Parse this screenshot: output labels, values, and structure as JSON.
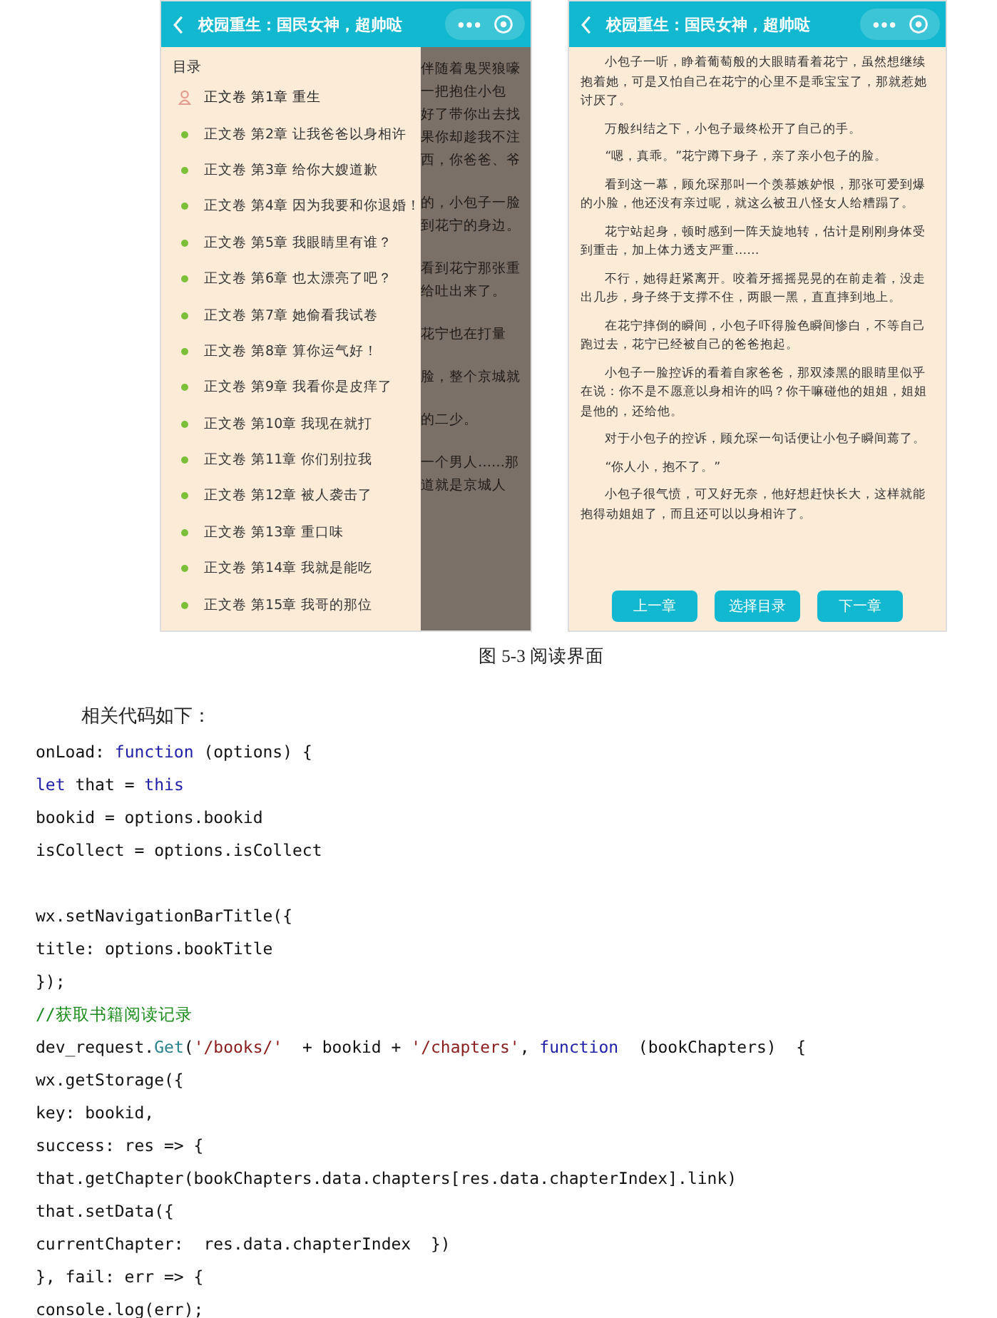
{
  "screens": [
    {
      "kind": "menu",
      "title": "校园重生：国民女神，超帅哒",
      "background_text": [
        [
          "伴随着鬼哭狼嚎",
          "一把抱住小包",
          "好了带你出去找",
          "果你却趁我不注",
          "西，你爸爸、爷"
        ],
        [
          "的，小包子一脸",
          "到花宁的身边。"
        ],
        [
          "看到花宁那张重",
          "给吐出来了。"
        ],
        [
          "花宁也在打量"
        ],
        [
          "脸，整个京城就"
        ],
        [
          "的二少。"
        ],
        [
          "一个男人……那",
          "道就是京城人"
        ]
      ],
      "toc_heading": "目录",
      "chapters": [
        {
          "label": "正文卷 第1章 重生",
          "selected": true
        },
        {
          "label": "正文卷 第2章 让我爸爸以身相许",
          "selected": false
        },
        {
          "label": "正文卷 第3章 给你大嫂道歉",
          "selected": false
        },
        {
          "label": "正文卷 第4章 因为我要和你退婚！",
          "selected": false
        },
        {
          "label": "正文卷 第5章 我眼睛里有谁？",
          "selected": false
        },
        {
          "label": "正文卷 第6章 也太漂亮了吧？",
          "selected": false
        },
        {
          "label": "正文卷 第7章 她偷看我试卷",
          "selected": false
        },
        {
          "label": "正文卷 第8章 算你运气好！",
          "selected": false
        },
        {
          "label": "正文卷 第9章 我看你是皮痒了",
          "selected": false
        },
        {
          "label": "正文卷 第10章 我现在就打",
          "selected": false
        },
        {
          "label": "正文卷 第11章 你们别拉我",
          "selected": false
        },
        {
          "label": "正文卷 第12章 被人袭击了",
          "selected": false
        },
        {
          "label": "正文卷 第13章 重口味",
          "selected": false
        },
        {
          "label": "正文卷 第14章 我就是能吃",
          "selected": false
        },
        {
          "label": "正文卷 第15章 我哥的那位",
          "selected": false
        }
      ]
    },
    {
      "kind": "reader",
      "title": "校园重生：国民女神，超帅哒",
      "paragraphs": [
        "小包子一听，睁着葡萄般的大眼睛看着花宁，虽然想继续抱着她，可是又怕自己在花宁的心里不是乖宝宝了，那就惹她讨厌了。",
        "万般纠结之下，小包子最终松开了自己的手。",
        "“嗯，真乖。”花宁蹲下身子，亲了亲小包子的脸。",
        "看到这一幕，顾允琛那叫一个羡慕嫉妒恨，那张可爱到爆的小脸，他还没有亲过呢，就这么被丑八怪女人给糟蹋了。",
        "花宁站起身，顿时感到一阵天旋地转，估计是刚刚身体受到重击，加上体力透支严重……",
        "不行，她得赶紧离开。咬着牙摇摇晃晃的在前走着，没走出几步，身子终于支撑不住，两眼一黑，直直摔到地上。",
        "在花宁摔倒的瞬间，小包子吓得脸色瞬间惨白，不等自己跑过去，花宁已经被自己的爸爸抱起。",
        "小包子一脸控诉的看着自家爸爸，那双漆黑的眼睛里似乎在说：你不是不愿意以身相许的吗？你干嘛碰他的姐姐，姐姐是他的，还给他。",
        "对于小包子的控诉，顾允琛一句话便让小包子瞬间蔫了。",
        "“你人小，抱不了。”",
        "小包子很气愤，可又好无奈，他好想赶快长大，这样就能抱得动姐姐了，而且还可以以身相许了。"
      ],
      "buttons": [
        "上一章",
        "选择目录",
        "下一章"
      ]
    }
  ],
  "caption": "图 5-3  阅读界面",
  "intro": "相关代码如下：",
  "code_lines": [
    [
      {
        "kind": "plain",
        "text": "onLoad: "
      },
      {
        "kind": "keyword",
        "text": "function"
      },
      {
        "kind": "plain",
        "text": " (options) {"
      }
    ],
    [
      {
        "kind": "keyword",
        "text": "let"
      },
      {
        "kind": "plain",
        "text": " that = "
      },
      {
        "kind": "keyword",
        "text": "this"
      }
    ],
    [
      {
        "kind": "plain",
        "text": "bookid = options.bookid"
      }
    ],
    [
      {
        "kind": "plain",
        "text": "isCollect = options.isCollect"
      }
    ],
    [
      {
        "kind": "blank"
      },
      {
        "kind": "plain",
        "text": "wx.setNavigationBarTitle({"
      }
    ],
    [
      {
        "kind": "plain",
        "text": "title: options.bookTitle"
      }
    ],
    [
      {
        "kind": "plain",
        "text": "});"
      }
    ],
    [
      {
        "kind": "comment",
        "text": "//获取书籍阅读记录"
      }
    ],
    [
      {
        "kind": "plain",
        "text": "dev_request."
      },
      {
        "kind": "method",
        "text": "Get"
      },
      {
        "kind": "plain",
        "text": "("
      },
      {
        "kind": "string",
        "text": "'/books/'"
      },
      {
        "kind": "plain",
        "text": "  + bookid + "
      },
      {
        "kind": "string",
        "text": "'/chapters'"
      },
      {
        "kind": "plain",
        "text": ", "
      },
      {
        "kind": "keyword",
        "text": "function"
      },
      {
        "kind": "plain",
        "text": "  (bookChapters)  {"
      }
    ],
    [
      {
        "kind": "plain",
        "text": "wx.getStorage({"
      }
    ],
    [
      {
        "kind": "plain",
        "text": "key: bookid,"
      }
    ],
    [
      {
        "kind": "plain",
        "text": "success: res => {"
      }
    ],
    [
      {
        "kind": "plain",
        "text": "that.getChapter(bookChapters.data.chapters[res.data.chapterIndex].link)"
      }
    ],
    [
      {
        "kind": "plain",
        "text": "that.setData({"
      }
    ],
    [
      {
        "kind": "plain",
        "text": "currentChapter:  res.data.chapterIndex  })"
      }
    ],
    [
      {
        "kind": "plain",
        "text": "}, fail: err => {"
      }
    ],
    [
      {
        "kind": "plain",
        "text": "console.log(err);"
      }
    ]
  ]
}
